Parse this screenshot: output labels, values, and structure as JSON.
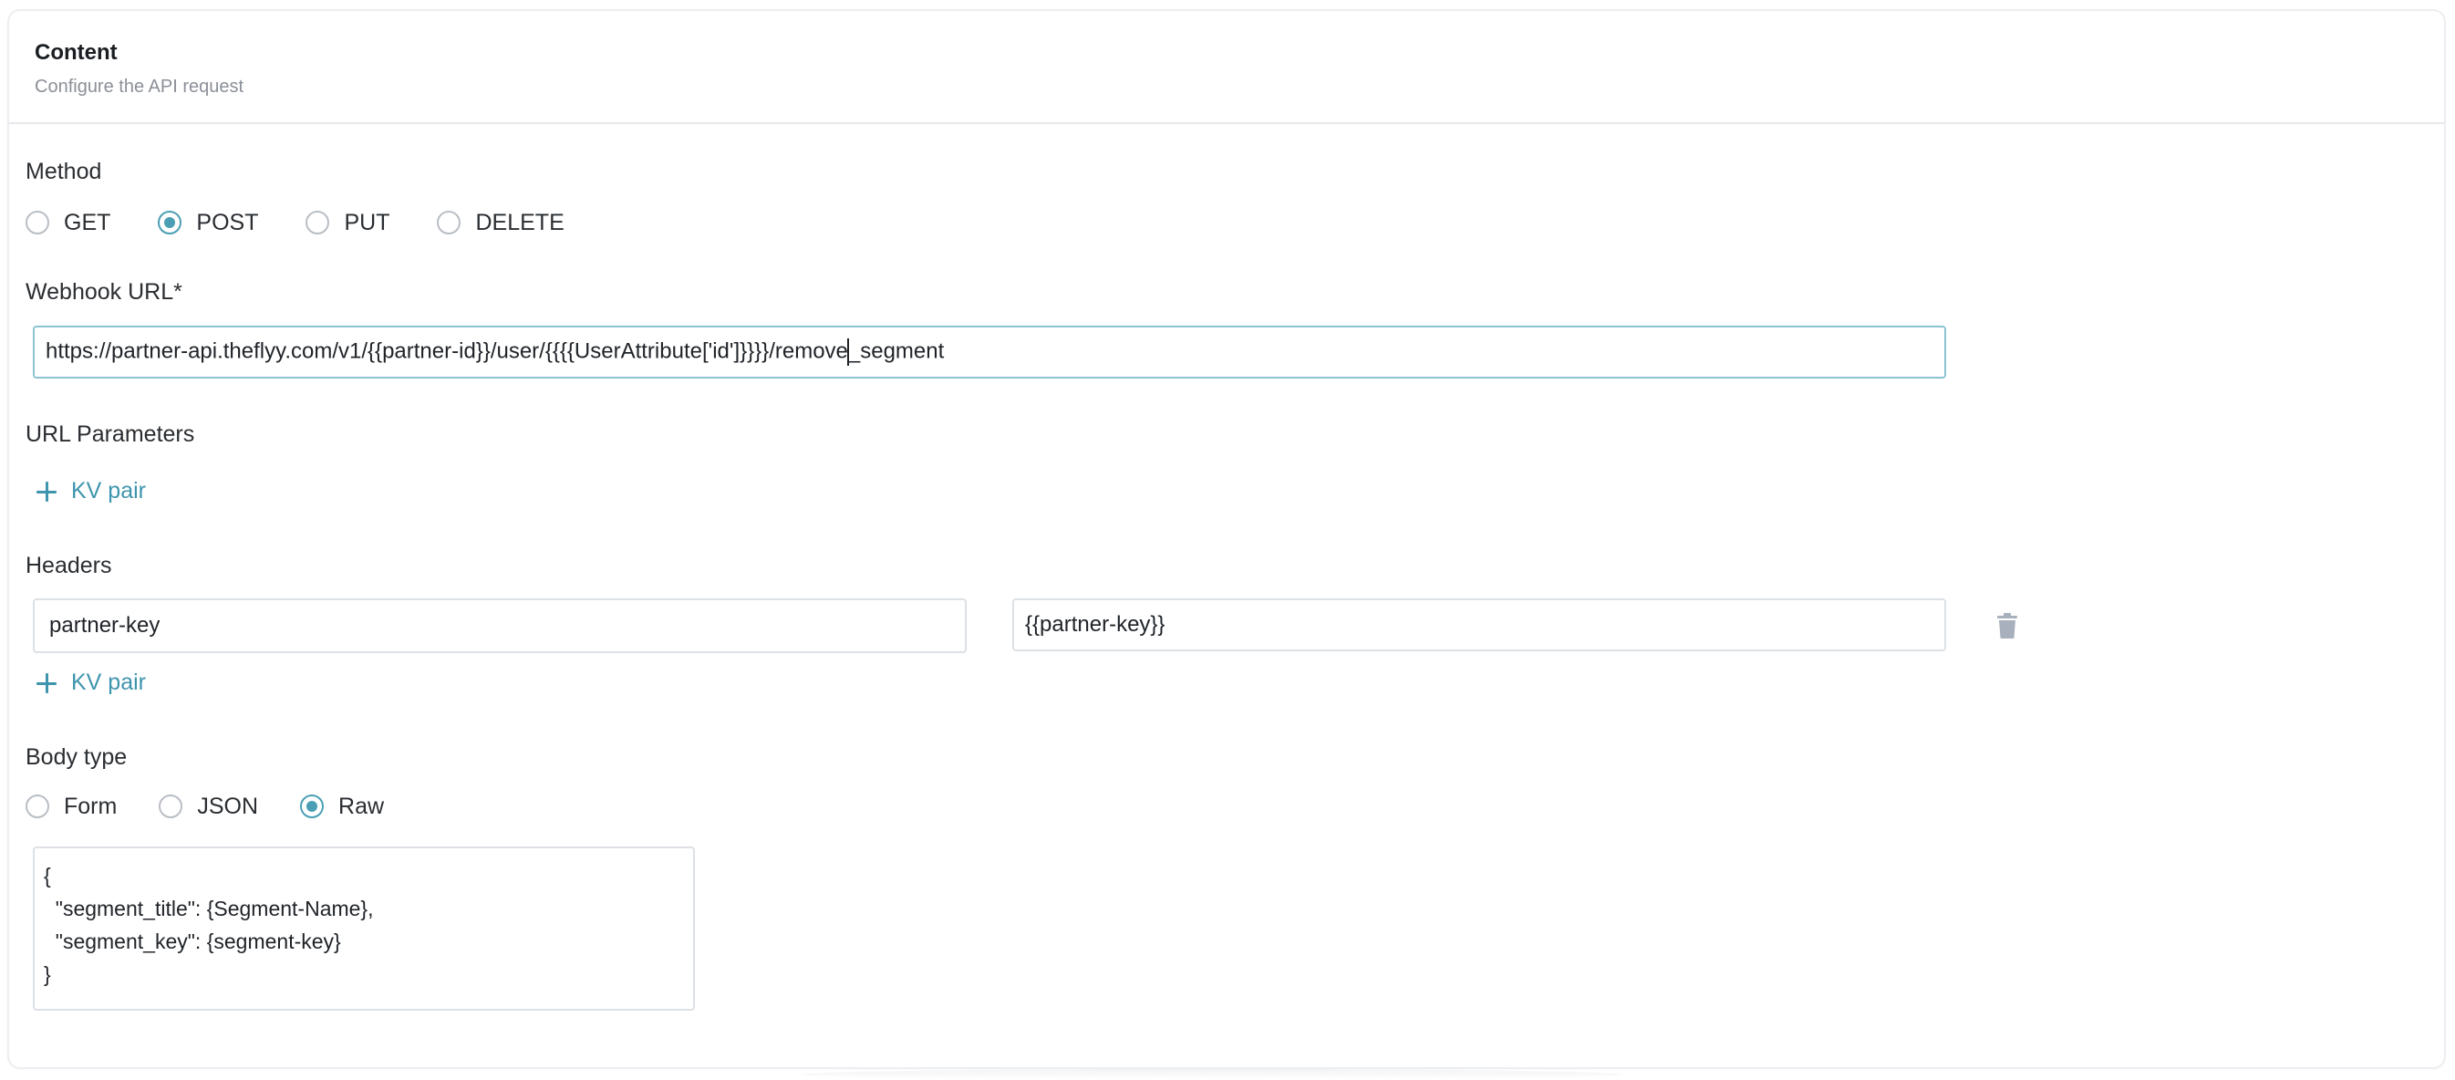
{
  "header": {
    "title": "Content",
    "subtitle": "Configure the API request"
  },
  "method": {
    "label": "Method",
    "options": [
      "GET",
      "POST",
      "PUT",
      "DELETE"
    ],
    "selected": "POST"
  },
  "webhook": {
    "label": "Webhook URL*",
    "value_before_caret": "https://partner-api.theflyy.com/v1/{{partner-id}}/user/{{{{UserAttribute['id']}}}}/remove",
    "value_after_caret": "_segment"
  },
  "url_params": {
    "label": "URL Parameters",
    "add_label": "KV pair"
  },
  "headers": {
    "label": "Headers",
    "rows": [
      {
        "key": "partner-key",
        "value": "{{partner-key}}"
      }
    ],
    "add_label": "KV pair"
  },
  "body_type": {
    "label": "Body type",
    "options": [
      "Form",
      "JSON",
      "Raw"
    ],
    "selected": "Raw",
    "raw_value": "{\n  \"segment_title\": {Segment-Name},\n  \"segment_key\": {segment-key}\n}"
  },
  "colors": {
    "accent": "#4a9fb5",
    "link": "#3f95ad",
    "trash": "#a9b0bd"
  },
  "icons": {
    "add": "plus-icon",
    "delete": "trash-icon"
  }
}
